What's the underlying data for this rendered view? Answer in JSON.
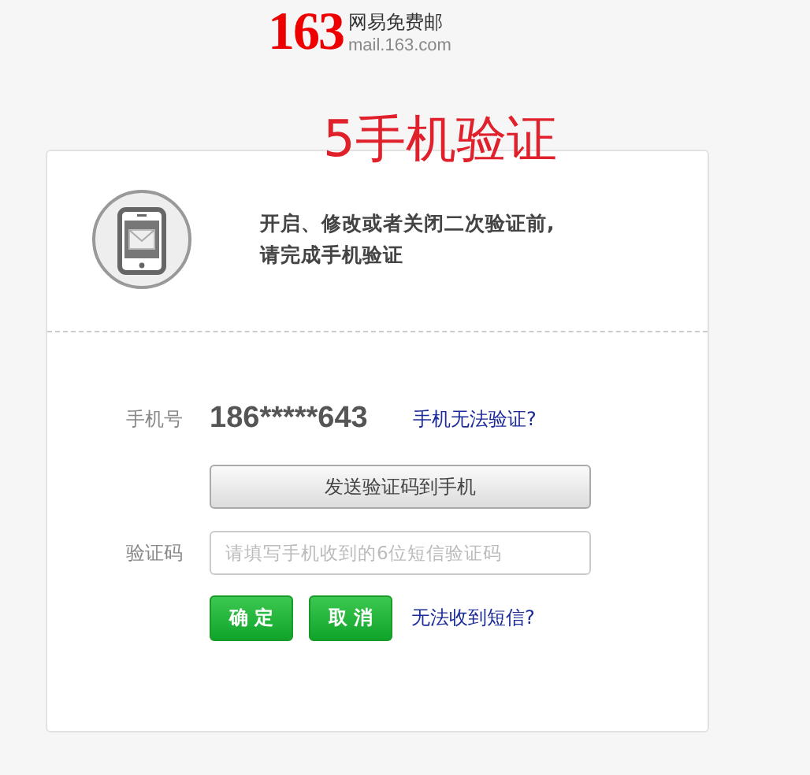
{
  "logo": {
    "mark": "163",
    "name": "网易免费邮",
    "domain": "mail.163.com"
  },
  "annotation": "5手机验证",
  "notice": {
    "lines": [
      "开启、修改或者关闭二次验证前,",
      "请完成手机验证"
    ]
  },
  "phone": {
    "label": "手机号",
    "value": "186*****643",
    "link": "手机无法验证?"
  },
  "send_button": "发送验证码到手机",
  "code": {
    "label": "验证码",
    "placeholder": "请填写手机收到的6位短信验证码"
  },
  "buttons": [
    {
      "label": "确 定"
    },
    {
      "label": "取 消"
    }
  ],
  "help_link": "无法收到短信?"
}
